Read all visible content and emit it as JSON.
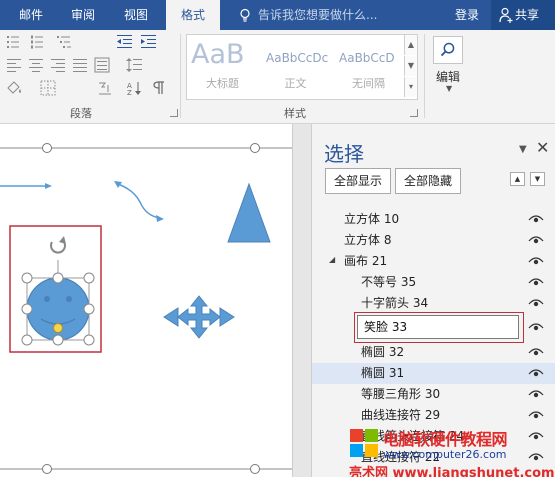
{
  "ribbon_tabs": [
    {
      "label": "邮件"
    },
    {
      "label": "审阅"
    },
    {
      "label": "视图"
    },
    {
      "label": "格式"
    }
  ],
  "tell_me": {
    "placeholder": "告诉我您想要做什么...",
    "icon": "lightbulb-icon"
  },
  "account": {
    "login": "登录",
    "share": "共享",
    "share_icon": "person-add-icon"
  },
  "ribbon": {
    "paragraph_group": "段落",
    "styles_group": "样式",
    "styles": [
      {
        "sample": "AaB",
        "caption": "大标题"
      },
      {
        "sample": "AaBbCcDc",
        "caption": "正文"
      },
      {
        "sample": "AaBbCcD",
        "caption": "无间隔"
      }
    ],
    "edit_label": "编辑",
    "edit_icon": "search-icon"
  },
  "selection_pane": {
    "title": "选择",
    "show_all": "全部显示",
    "hide_all": "全部隐藏",
    "editing_value": "笑脸 33",
    "items": [
      {
        "label": "立方体 10",
        "level": 0
      },
      {
        "label": "立方体 8",
        "level": 0
      },
      {
        "label": "画布 21",
        "level": 0,
        "expanded": true
      },
      {
        "label": "不等号 35",
        "level": 1
      },
      {
        "label": "十字箭头 34",
        "level": 1
      },
      {
        "label": "笑脸 33",
        "level": 1,
        "editing": true
      },
      {
        "label": "椭圆 32",
        "level": 1
      },
      {
        "label": "椭圆 31",
        "level": 1,
        "highlighted": true
      },
      {
        "label": "等腰三角形 30",
        "level": 1
      },
      {
        "label": "曲线连接符 29",
        "level": 1
      },
      {
        "label": "直线箭头连接符 24",
        "level": 1
      },
      {
        "label": "直线连接符 22",
        "level": 1
      }
    ]
  },
  "colors": {
    "accent": "#2b579a",
    "shape_fill": "#5b9bd5",
    "highlight_row": "#dce6f4",
    "red_frame": "#c0313b"
  },
  "watermark": {
    "line1": "电脑软硬件教程网",
    "line2": "www.computer26.com",
    "line3": "亮术网 www.liangshunet.com"
  }
}
